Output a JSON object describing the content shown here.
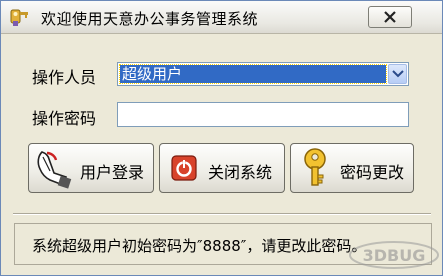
{
  "window": {
    "title": "欢迎使用天意办公事务管理系统"
  },
  "form": {
    "user_label": "操作人员",
    "user_selected": "超级用户",
    "password_label": "操作密码",
    "password_value": ""
  },
  "buttons": {
    "login_label": "用户登录",
    "close_label": "关闭系统",
    "change_pwd_label": "密码更改"
  },
  "status": {
    "message": "系统超级用户初始密码为″8888″，请更改此密码。"
  },
  "watermark": {
    "text": "3DBUG"
  },
  "icons": {
    "app": "keys-app-icon",
    "close": "close-x-icon",
    "dropdown": "chevron-down-icon",
    "login": "hand-pointer-icon",
    "shutdown": "power-icon",
    "key": "key-icon"
  }
}
